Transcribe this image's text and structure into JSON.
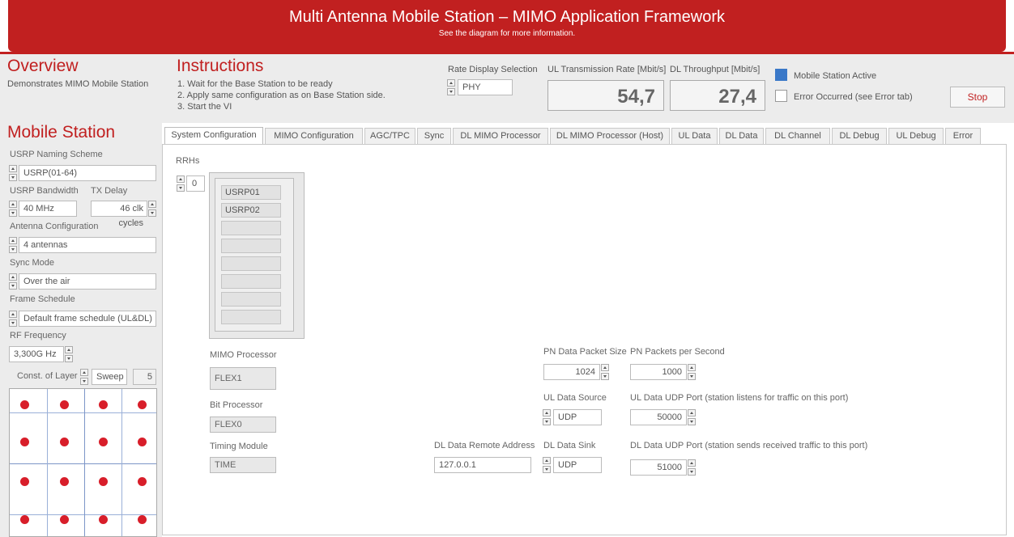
{
  "header": {
    "title": "Multi Antenna Mobile Station – MIMO Application Framework",
    "subtitle": "See the diagram for more information."
  },
  "overview": {
    "title": "Overview",
    "text": "Demonstrates MIMO Mobile Station"
  },
  "instructions": {
    "title": "Instructions",
    "steps": [
      "1. Wait for the Base Station to be ready",
      "2. Apply same configuration as on Base Station side.",
      "3. Start the VI"
    ]
  },
  "rate_display": {
    "label": "Rate Display Selection",
    "value": "PHY"
  },
  "ul_rate": {
    "label": "UL Transmission Rate [Mbit/s]",
    "value": "54,7"
  },
  "dl_rate": {
    "label": "DL Throughput [Mbit/s]",
    "value": "27,4"
  },
  "status": {
    "active_label": "Mobile Station Active",
    "active": true,
    "error_label": "Error Occurred (see Error tab)",
    "error": false
  },
  "stop_label": "Stop",
  "left": {
    "title": "Mobile Station",
    "naming_label": "USRP Naming Scheme",
    "naming_value": "USRP(01-64)",
    "bandwidth_label": "USRP Bandwidth",
    "bandwidth_value": "40 MHz",
    "txdelay_label": "TX Delay",
    "txdelay_value": "46 clk cycles",
    "antenna_label": "Antenna Configuration",
    "antenna_value": "4 antennas",
    "sync_label": "Sync Mode",
    "sync_value": "Over the air",
    "frame_label": "Frame Schedule",
    "frame_value": "Default frame schedule (UL&DL)",
    "rf_label": "RF Frequency",
    "rf_value": "3,300G Hz",
    "const_label": "Const. of Layer",
    "const_mode": "Sweep",
    "const_layer": "5"
  },
  "tabs": [
    "System Configuration",
    "MIMO Configuration",
    "AGC/TPC",
    "Sync",
    "DL MIMO Processor",
    "DL MIMO Processor (Host)",
    "UL Data",
    "DL Data",
    "DL Channel",
    "DL Debug",
    "UL Debug",
    "Error"
  ],
  "active_tab": 0,
  "sys": {
    "rrhs_label": "RRHs",
    "rrh_index": "0",
    "rrh_items": [
      "USRP01",
      "USRP02",
      "",
      "",
      "",
      "",
      "",
      ""
    ],
    "mimo_proc_label": "MIMO Processor",
    "mimo_proc_value": "FLEX1",
    "bit_proc_label": "Bit Processor",
    "bit_proc_value": "FLEX0",
    "timing_label": "Timing Module",
    "timing_value": "TIME",
    "pn_size_label": "PN Data Packet Size",
    "pn_size_value": "1024",
    "pn_pps_label": "PN Packets per Second",
    "pn_pps_value": "1000",
    "ul_src_label": "UL Data Source",
    "ul_src_value": "UDP",
    "ul_port_label": "UL Data UDP Port (station listens for traffic on this port)",
    "ul_port_value": "50000",
    "dl_addr_label": "DL Data Remote Address",
    "dl_addr_value": "127.0.0.1",
    "dl_sink_label": "DL Data Sink",
    "dl_sink_value": "UDP",
    "dl_port_label": "DL Data UDP Port (station sends received traffic to this port)",
    "dl_port_value": "51000"
  },
  "colors": {
    "brand": "#c12020",
    "dot": "#d81e2a",
    "active": "#3a78c8"
  }
}
